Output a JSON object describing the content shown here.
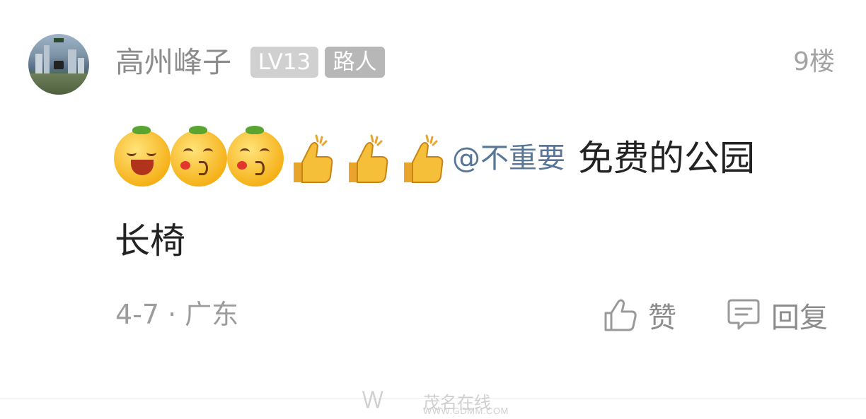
{
  "post": {
    "username": "高州峰子",
    "level_badge": "LV13",
    "role_badge": "路人",
    "floor": "9楼",
    "emojis": [
      "grinning-orange-emoji",
      "kiss-orange-emoji",
      "kiss-orange-emoji",
      "thumbs-up-emoji",
      "thumbs-up-emoji",
      "thumbs-up-emoji"
    ],
    "mention": "@不重要",
    "text_line1": "免费的公园",
    "text_line2": "长椅",
    "date": "4-7",
    "separator": "·",
    "location": "广东"
  },
  "actions": {
    "like_label": "赞",
    "reply_label": "回复"
  },
  "watermark": {
    "logo": "\\/\\/",
    "text": "茂名在线",
    "url": "WWW.GDMM.COM"
  },
  "colors": {
    "mention": "#587698",
    "muted": "#8c8c8c",
    "text": "#222222"
  }
}
